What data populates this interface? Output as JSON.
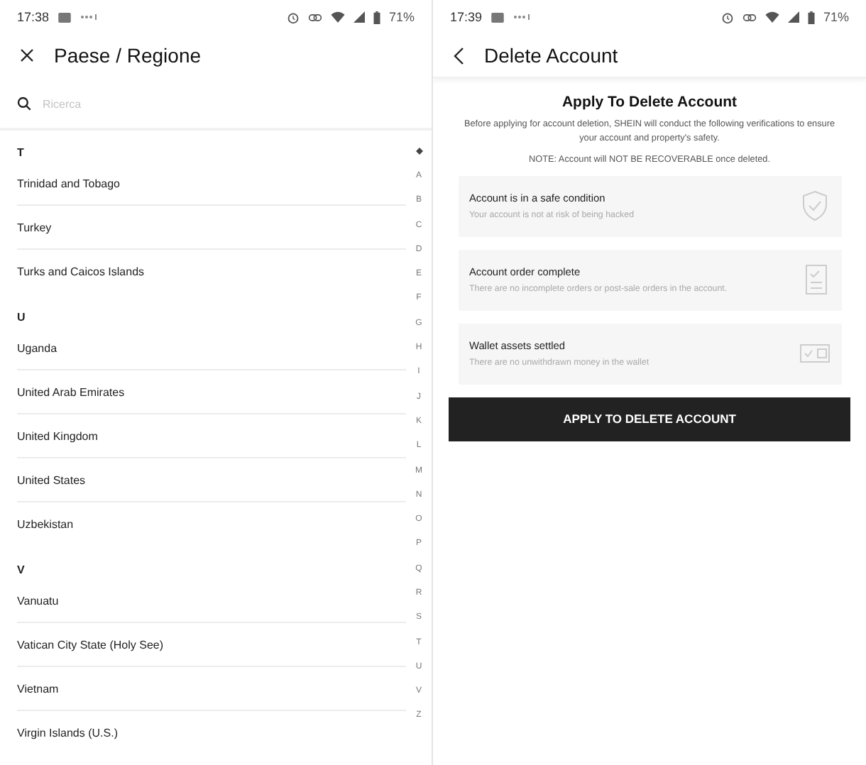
{
  "left_screen": {
    "status_bar": {
      "time": "17:38",
      "battery": "71%"
    },
    "header": {
      "title": "Paese / Regione"
    },
    "search": {
      "placeholder": "Ricerca"
    },
    "sections": [
      {
        "letter": "T",
        "countries": [
          "Trinidad and Tobago",
          "Turkey",
          "Turks and Caicos Islands"
        ]
      },
      {
        "letter": "U",
        "countries": [
          "Uganda",
          "United Arab Emirates",
          "United Kingdom",
          "United States",
          "Uzbekistan"
        ]
      },
      {
        "letter": "V",
        "countries": [
          "Vanuatu",
          "Vatican City State (Holy See)",
          "Vietnam",
          "Virgin Islands (U.S.)"
        ]
      }
    ],
    "index": [
      "A",
      "B",
      "C",
      "D",
      "E",
      "F",
      "G",
      "H",
      "I",
      "J",
      "K",
      "L",
      "M",
      "N",
      "O",
      "P",
      "Q",
      "R",
      "S",
      "T",
      "U",
      "V",
      "Z"
    ]
  },
  "right_screen": {
    "status_bar": {
      "time": "17:39",
      "battery": "71%"
    },
    "header": {
      "title": "Delete Account"
    },
    "heading": "Apply To Delete Account",
    "intro": "Before applying for account deletion, SHEIN will conduct the following verifications to ensure your account and property's safety.",
    "note": "NOTE: Account will NOT BE RECOVERABLE once deleted.",
    "checks": [
      {
        "kind": "shield",
        "title": "Account is in a safe condition",
        "detail": "Your account is not at risk of being hacked"
      },
      {
        "kind": "list",
        "title": "Account order complete",
        "detail": "There are no incomplete orders or post-sale orders in the account."
      },
      {
        "kind": "wallet",
        "title": "Wallet assets settled",
        "detail": "There are no unwithdrawn money in the wallet"
      }
    ],
    "button": "APPLY TO DELETE ACCOUNT"
  }
}
